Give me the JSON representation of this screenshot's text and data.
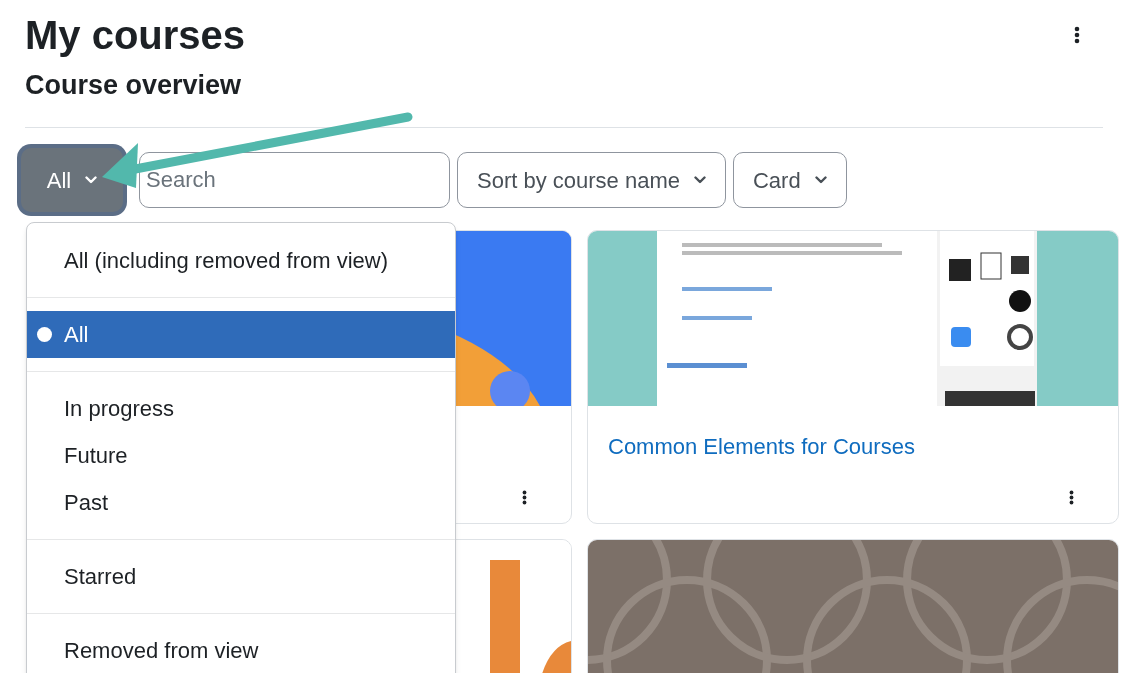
{
  "page": {
    "title": "My courses",
    "section_title": "Course overview"
  },
  "controls": {
    "filter": {
      "label": "All",
      "expanded": true
    },
    "search": {
      "placeholder": "Search"
    },
    "sort": {
      "label": "Sort by course name"
    },
    "view": {
      "label": "Card"
    }
  },
  "filter_menu": {
    "groups": [
      [
        {
          "label": "All (including removed from view)",
          "selected": false
        }
      ],
      [
        {
          "label": "All",
          "selected": true
        }
      ],
      [
        {
          "label": "In progress",
          "selected": false
        },
        {
          "label": "Future",
          "selected": false
        },
        {
          "label": "Past",
          "selected": false
        }
      ],
      [
        {
          "label": "Starred",
          "selected": false
        }
      ],
      [
        {
          "label": "Removed from view",
          "selected": false
        }
      ]
    ]
  },
  "course_cards": [
    {
      "kind": "gears",
      "has_menu": true
    },
    {
      "kind": "screenshot",
      "title": "Common Elements for Courses",
      "has_menu": true
    },
    {
      "kind": "letters"
    },
    {
      "kind": "circles"
    }
  ]
}
